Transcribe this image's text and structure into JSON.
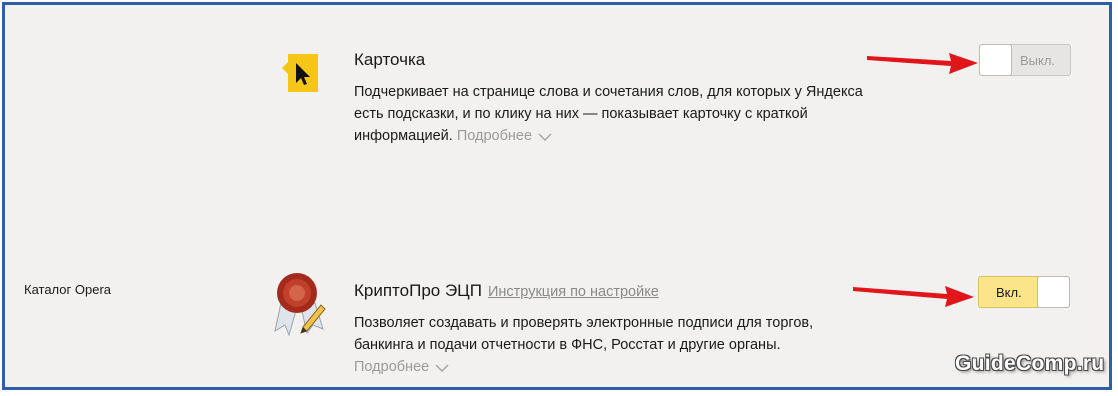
{
  "sidebar": {
    "category": "Каталог Opera"
  },
  "extensions": [
    {
      "title": "Карточка",
      "description": "Подчеркивает на странице слова и сочетания слов, для которых у Яндекса есть подсказки, и по клику на них — показывает карточку с краткой информацией.",
      "desc_lines": [
        "Подчеркивает на странице слова и сочетания слов, для которых у Яндекса",
        "есть подсказки, и по клику на них — показывает карточку с краткой",
        "информацией."
      ],
      "more_label": "Подробнее",
      "toggle_label": "Выкл.",
      "toggle_state": "off",
      "icon": "cursor-card-icon"
    },
    {
      "title": "КриптоПро ЭЦП",
      "link": "Инструкция по настройке",
      "desc_lines": [
        "Позволяет создавать и проверять электронные подписи для торгов,",
        "банкинга и подачи отчетности в ФНС, Росстат и другие органы."
      ],
      "more_label": "Подробнее",
      "toggle_label": "Вкл.",
      "toggle_state": "on",
      "icon": "wax-seal-certificate-icon"
    }
  ],
  "colors": {
    "frame_border": "#2f5ea8",
    "toggle_on": "#fbe48a",
    "arrow": "#e0161b",
    "card_icon_yellow": "#f5c518"
  },
  "watermark": "GuideComp.ru"
}
